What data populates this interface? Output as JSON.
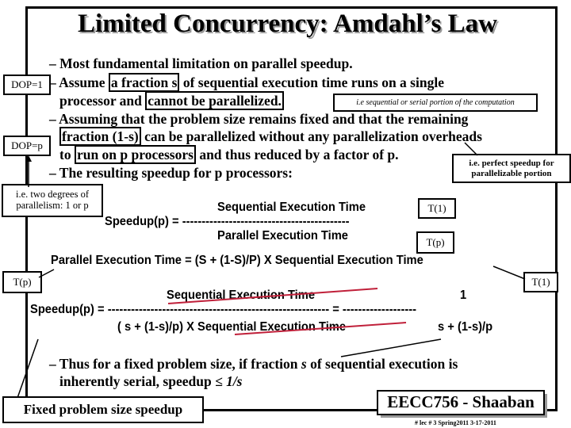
{
  "title": "Limited Concurrency: Amdahl’s Law",
  "bullets": {
    "b1": "– Most fundamental limitation on parallel speedup.",
    "b2_pre": "– Assume ",
    "b2_box": "a fraction s",
    "b2_post": " of sequential execution time runs on a single",
    "b3_pre": "processor and ",
    "b3_box": "cannot be parallelized.",
    "b4": "– Assuming that the problem size remains fixed and that the remaining",
    "b5_box": "fraction (1-s)",
    "b5_post": " can be parallelized without any parallelization overheads",
    "b6_pre": "to ",
    "b6_box": "run on p processors",
    "b6_post": " and thus reduced by a factor of p.",
    "b7": "– The resulting speedup for p processors:",
    "b8": "– Thus for a fixed problem size, if fraction ",
    "b8_s": "s",
    "b8_post": " of sequential execution is",
    "b9": "inherently serial, speedup ",
    "b9_math": "≤ 1/s"
  },
  "callouts": {
    "dop1": "DOP=1",
    "dopp": "DOP=p",
    "two_degrees": "i.e. two degrees of parallelism: 1 or p",
    "sequential_note": "i.e sequential or serial portion of the computation",
    "perfect": "i.e. perfect speedup for parallelizable portion",
    "t1a": "T(1)",
    "tpa": "T(p)",
    "tpb": "T(p)",
    "t1b": "T(1)",
    "fixed": "Fixed problem size speedup"
  },
  "formulas": {
    "f1_num": "Sequential Execution Time",
    "f1_lhs": "Speedup(p) =  -------------------------------------------",
    "f1_den": "Parallel Execution Time",
    "f2": "Parallel Execution Time  =  (S + (1-S)/P) X Sequential Execution Time",
    "f3_num": "Sequential Execution Time",
    "f3_one": "1",
    "f3_lhs": "Speedup(p) =  ---------------------------------------------------------  =  -------------------",
    "f3_den": "( s  + (1-s)/p) X Sequential Execution Time",
    "f3_den2": "s +  (1-s)/p"
  },
  "footer": {
    "course": "EECC756 - Shaaban",
    "info": "#  lec # 3   Spring2011   3-17-2011"
  },
  "colors": {
    "strike": "#c0203a",
    "shadow": "#999999"
  }
}
